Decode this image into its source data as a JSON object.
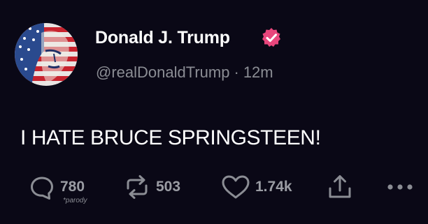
{
  "author": {
    "display_name": "Donald J. Trump",
    "handle": "@realDonaldTrump",
    "separator": "·",
    "time": "12m"
  },
  "post": {
    "text": "I HATE BRUCE SPRINGSTEEN!"
  },
  "actions": {
    "reply_count": "780",
    "repost_count": "503",
    "like_count": "1.74k",
    "parody_label": "*parody"
  },
  "colors": {
    "background": "#0a0816",
    "verified_badge": "#e8467c",
    "muted_text": "#8b8d94",
    "primary_text": "#ffffff"
  },
  "icons": {
    "reply": "reply-bubble-icon",
    "repost": "repost-arrows-icon",
    "like": "heart-icon",
    "share": "share-upload-icon",
    "more": "more-dots-icon",
    "verified": "verified-badge-icon"
  }
}
